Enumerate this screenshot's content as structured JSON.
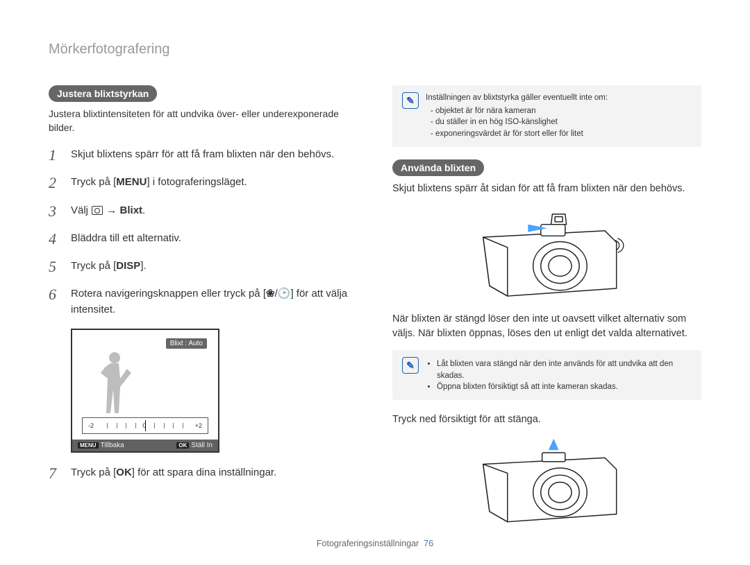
{
  "page_title": "Mörkerfotografering",
  "left": {
    "section_badge": "Justera blixtstyrkan",
    "intro": "Justera blixtintensiteten för att undvika över- eller underexponerade bilder.",
    "steps": {
      "s1": "Skjut blixtens spärr för att få fram blixten när den behövs.",
      "s2_a": "Tryck på [",
      "s2_btn": "MENU",
      "s2_b": "] i fotograferingsläget.",
      "s3_a": "Välj ",
      "s3_b": " → ",
      "s3_bold": "Blixt",
      "s3_c": ".",
      "s4": "Bläddra till ett alternativ.",
      "s5_a": "Tryck på [",
      "s5_btn": "DISP",
      "s5_b": "].",
      "s6_a": "Rotera navigeringsknappen eller tryck på [",
      "s6_sep": "/",
      "s6_b": "] för att välja intensitet.",
      "s7_a": "Tryck på [",
      "s7_btn": "OK",
      "s7_b": "] för att spara dina inställningar."
    },
    "lcd": {
      "label": "Blixt : Auto",
      "minus": "-2",
      "zero": "0",
      "plus": "+2",
      "back_btn": "MENU",
      "back_label": "Tillbaka",
      "set_btn": "OK",
      "set_label": "Ställ In"
    }
  },
  "right": {
    "note1": {
      "lead": "Inställningen av blixtstyrka gäller eventuellt inte om:",
      "i1": "objektet är för nära kameran",
      "i2": "du ställer in en hög ISO-känslighet",
      "i3": "exponeringsvärdet är för stort eller för litet"
    },
    "section_badge": "Använda blixten",
    "intro": "Skjut blixtens spärr åt sidan för att få fram blixten när den behövs.",
    "closed_text": "När blixten är stängd löser den inte ut oavsett vilket alternativ som väljs. När blixten öppnas, löses den ut enligt det valda alternativet.",
    "note2": {
      "i1": "Låt blixten vara stängd när den inte används för att undvika att den skadas.",
      "i2": "Öppna blixten försiktigt så att inte kameran skadas."
    },
    "close_instr": "Tryck ned försiktigt för att stänga."
  },
  "footer": {
    "section": "Fotograferingsinställningar",
    "page": "76"
  }
}
